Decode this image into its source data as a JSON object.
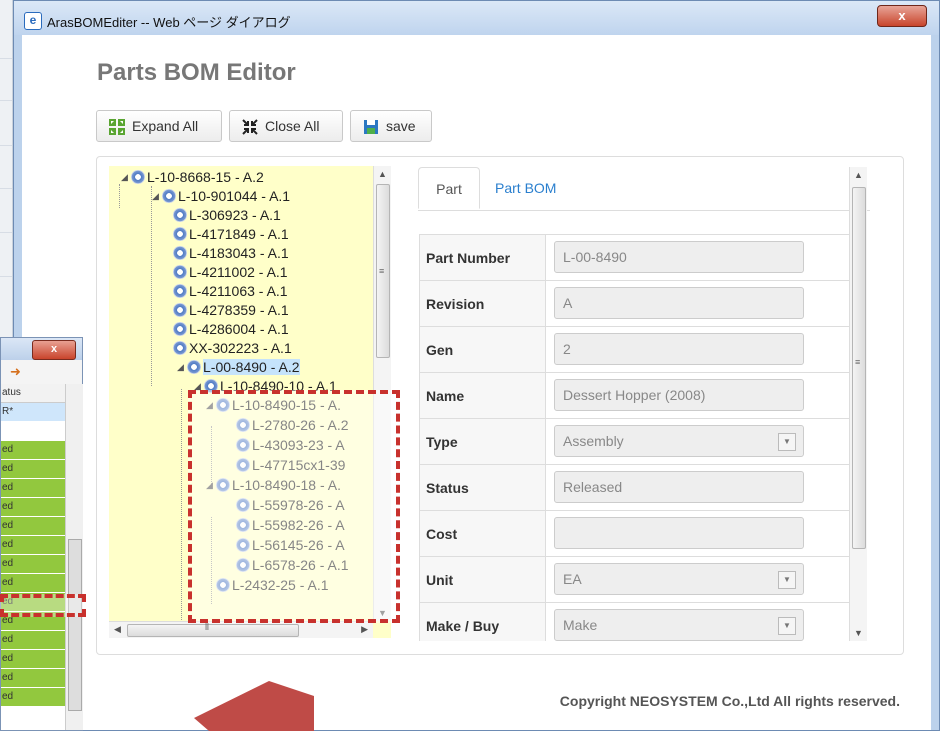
{
  "window": {
    "title": "ArasBOMEditer -- Web ページ ダイアログ",
    "close_label": "x"
  },
  "page": {
    "title": "Parts BOM Editor",
    "copyright": "Copyright NEOSYSTEM Co.,Ltd All rights reserved."
  },
  "toolbar": {
    "expand_label": "Expand All",
    "close_label": "Close All",
    "save_label": "save"
  },
  "tree": {
    "nodes": [
      {
        "label": "L-10-8668-15 - A.2"
      },
      {
        "label": "L-10-901044 - A.1"
      },
      {
        "label": "L-306923 - A.1"
      },
      {
        "label": "L-4171849 - A.1"
      },
      {
        "label": "L-4183043 - A.1"
      },
      {
        "label": "L-4211002 - A.1"
      },
      {
        "label": "L-4211063 - A.1"
      },
      {
        "label": "L-4278359 - A.1"
      },
      {
        "label": "L-4286004 - A.1"
      },
      {
        "label": "XX-302223 - A.1"
      },
      {
        "label": "L-00-8490 - A.2"
      },
      {
        "label": "L-10-8490-10 - A.1"
      },
      {
        "label": "L-10-8490-15 - A."
      },
      {
        "label": "L-2780-26 - A.2"
      },
      {
        "label": "L-43093-23 - A"
      },
      {
        "label": "L-47715cx1-39"
      },
      {
        "label": "L-10-8490-18 - A."
      },
      {
        "label": "L-55978-26 - A"
      },
      {
        "label": "L-55982-26 - A"
      },
      {
        "label": "L-56145-26 - A"
      },
      {
        "label": "L-6578-26 - A.1"
      },
      {
        "label": "L-2432-25 - A.1"
      }
    ]
  },
  "detail": {
    "tabs": [
      {
        "label": "Part"
      },
      {
        "label": "Part BOM"
      }
    ],
    "fields": [
      {
        "label": "Part Number",
        "value": "L-00-8490"
      },
      {
        "label": "Revision",
        "value": "A"
      },
      {
        "label": "Gen",
        "value": "2"
      },
      {
        "label": "Name",
        "value": "Dessert Hopper (2008)"
      },
      {
        "label": "Type",
        "value": "Assembly"
      },
      {
        "label": "Status",
        "value": "Released"
      },
      {
        "label": "Cost",
        "value": ""
      },
      {
        "label": "Unit",
        "value": "EA"
      },
      {
        "label": "Make / Buy",
        "value": "Make"
      }
    ]
  },
  "back_window": {
    "close_label": "x",
    "column_header": "atus",
    "rows": [
      "R*",
      "",
      "ed",
      "ed",
      "ed",
      "ed",
      "ed",
      "ed",
      "ed",
      "ed",
      "ed",
      "ed",
      "ed",
      "ed",
      "ed",
      "ed"
    ]
  },
  "colors": {
    "tree_background": "#ffffc9",
    "status_green": "#92c83e",
    "highlight_red": "#c8312d",
    "link_blue": "#2a7fce"
  }
}
